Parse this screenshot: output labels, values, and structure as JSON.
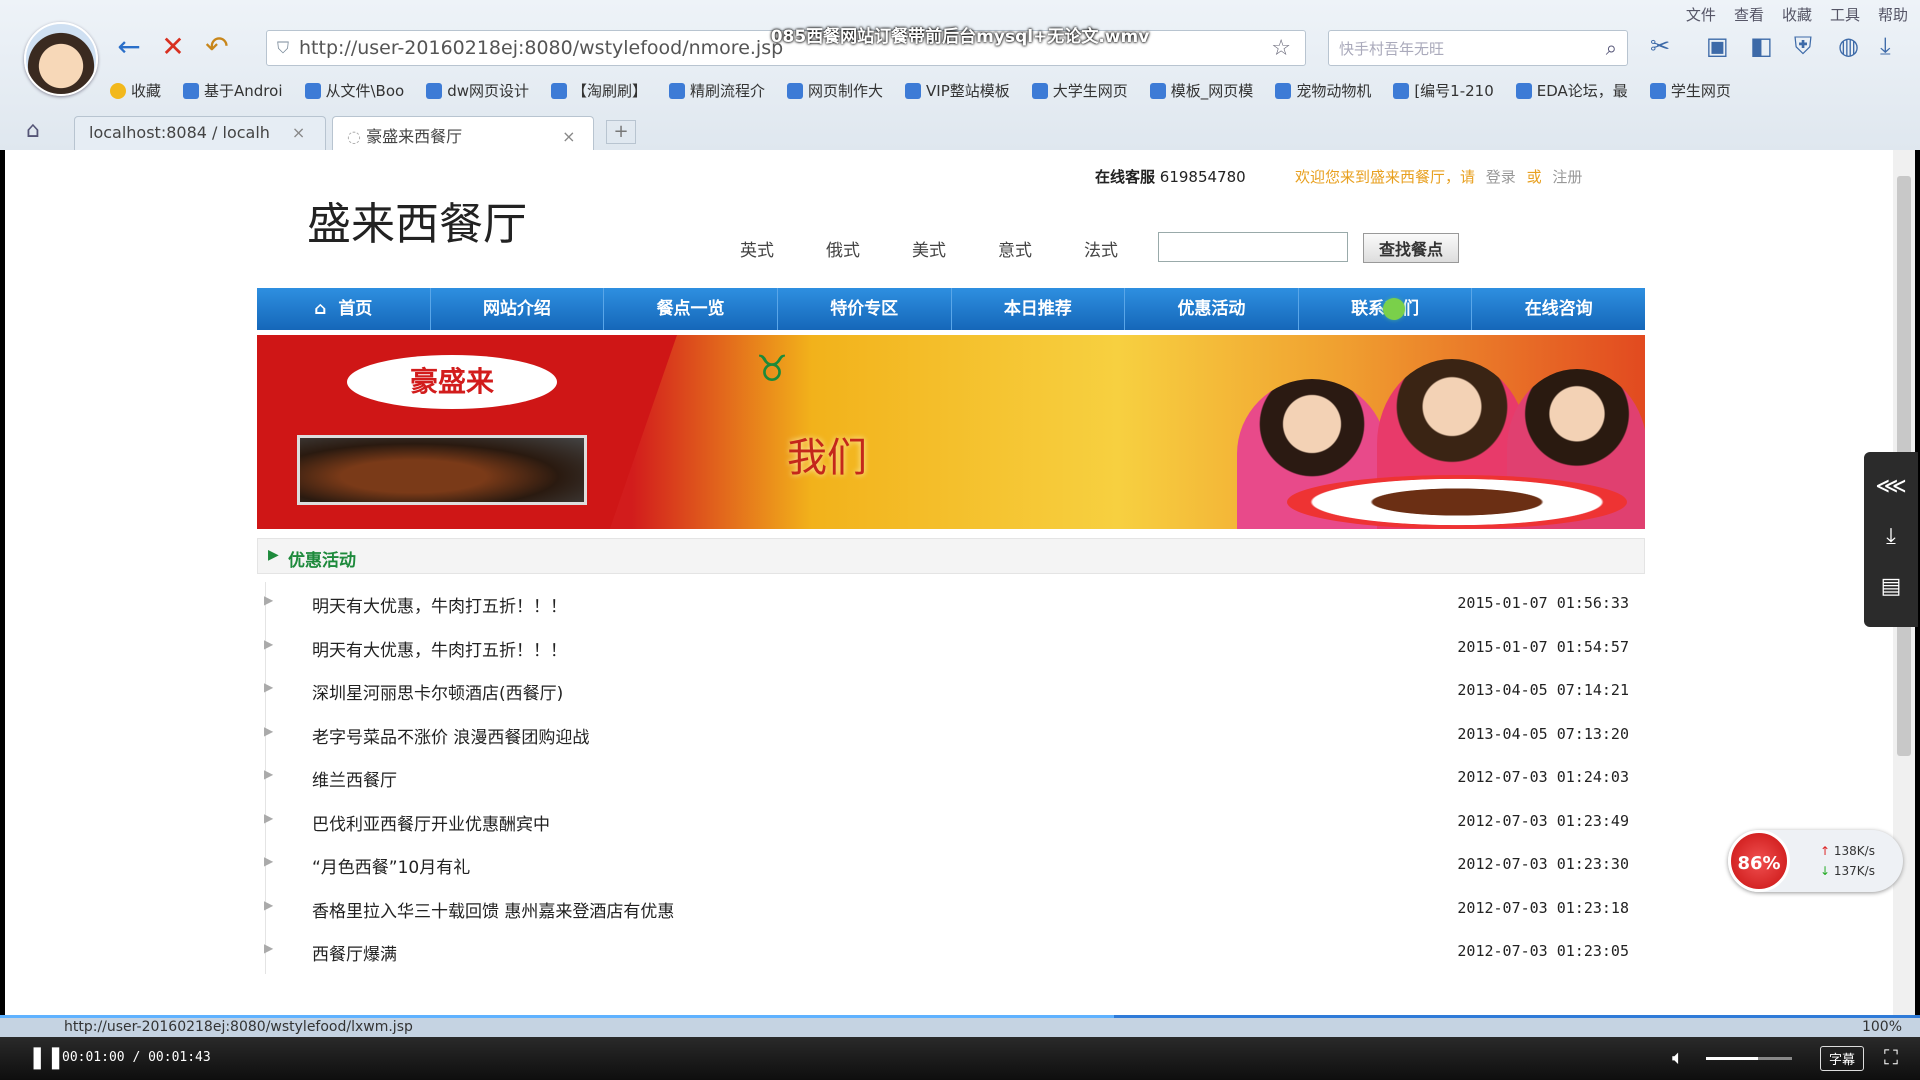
{
  "video": {
    "title": "085西餐网站订餐带前后台mysql+无论文.wmv",
    "time": "00:01:00 / 00:01:43",
    "progress": 0.58,
    "volume": 0.6,
    "subtitle_label": "字幕"
  },
  "browser": {
    "menu": [
      "文件",
      "查看",
      "收藏",
      "工具",
      "帮助"
    ],
    "url": "http://user-20160218ej:8080/wstylefood/nmore.jsp",
    "search_placeholder": "快手村吾年无旺",
    "bookmarks": [
      "收藏",
      "基于Androi",
      "从文件\\Boo",
      "dw网页设计",
      "【淘刷刷】",
      "精刷流程介",
      "网页制作大",
      "VIP整站模板",
      "大学生网页",
      "模板_网页模",
      "宠物动物机",
      "[编号1-210",
      "EDA论坛，最",
      "学生网页"
    ],
    "tabs": [
      {
        "label": "localhost:8084 / localh"
      },
      {
        "label": "豪盛来西餐厅"
      }
    ],
    "status_url": "http://user-20160218ej:8080/wstylefood/lxwm.jsp",
    "zoom": "100%"
  },
  "site": {
    "service_label": "在线客服",
    "service_phone": "619854780",
    "welcome": "欢迎您来到盛来西餐厅，请",
    "login": "登录",
    "or": "或",
    "register": "注册",
    "title": "盛来西餐厅",
    "cuisines": [
      "英式",
      "俄式",
      "美式",
      "意式",
      "法式"
    ],
    "search_button": "查找餐点",
    "nav": [
      "首页",
      "网站介绍",
      "餐点一览",
      "特价专区",
      "本日推荐",
      "优惠活动",
      "联系我们",
      "在线咨询"
    ],
    "banner": {
      "logo_text": "豪盛来",
      "slogan": "我们"
    },
    "section_title": "优惠活动",
    "news": [
      {
        "title": "明天有大优惠，牛肉打五折！！！",
        "date": "2015-01-07 01:56:33"
      },
      {
        "title": "明天有大优惠，牛肉打五折！！！",
        "date": "2015-01-07 01:54:57"
      },
      {
        "title": "深圳星河丽思卡尔顿酒店(西餐厅)",
        "date": "2013-04-05 07:14:21"
      },
      {
        "title": "老字号菜品不涨价 浪漫西餐团购迎战",
        "date": "2013-04-05 07:13:20"
      },
      {
        "title": "维兰西餐厅",
        "date": "2012-07-03 01:24:03"
      },
      {
        "title": "巴伐利亚西餐厅开业优惠酬宾中",
        "date": "2012-07-03 01:23:49"
      },
      {
        "title": "“月色西餐”10月有礼",
        "date": "2012-07-03 01:23:30"
      },
      {
        "title": "香格里拉入华三十载回馈 惠州嘉来登酒店有优惠",
        "date": "2012-07-03 01:23:18"
      },
      {
        "title": "西餐厅爆满",
        "date": "2012-07-03 01:23:05"
      }
    ]
  },
  "speed": {
    "percent": "86%",
    "up": "138K/s",
    "down": "137K/s"
  },
  "colors": {
    "nav_blue": "#1a74c9",
    "section_green": "#1e8a3c",
    "welcome_orange": "#e8a020"
  }
}
